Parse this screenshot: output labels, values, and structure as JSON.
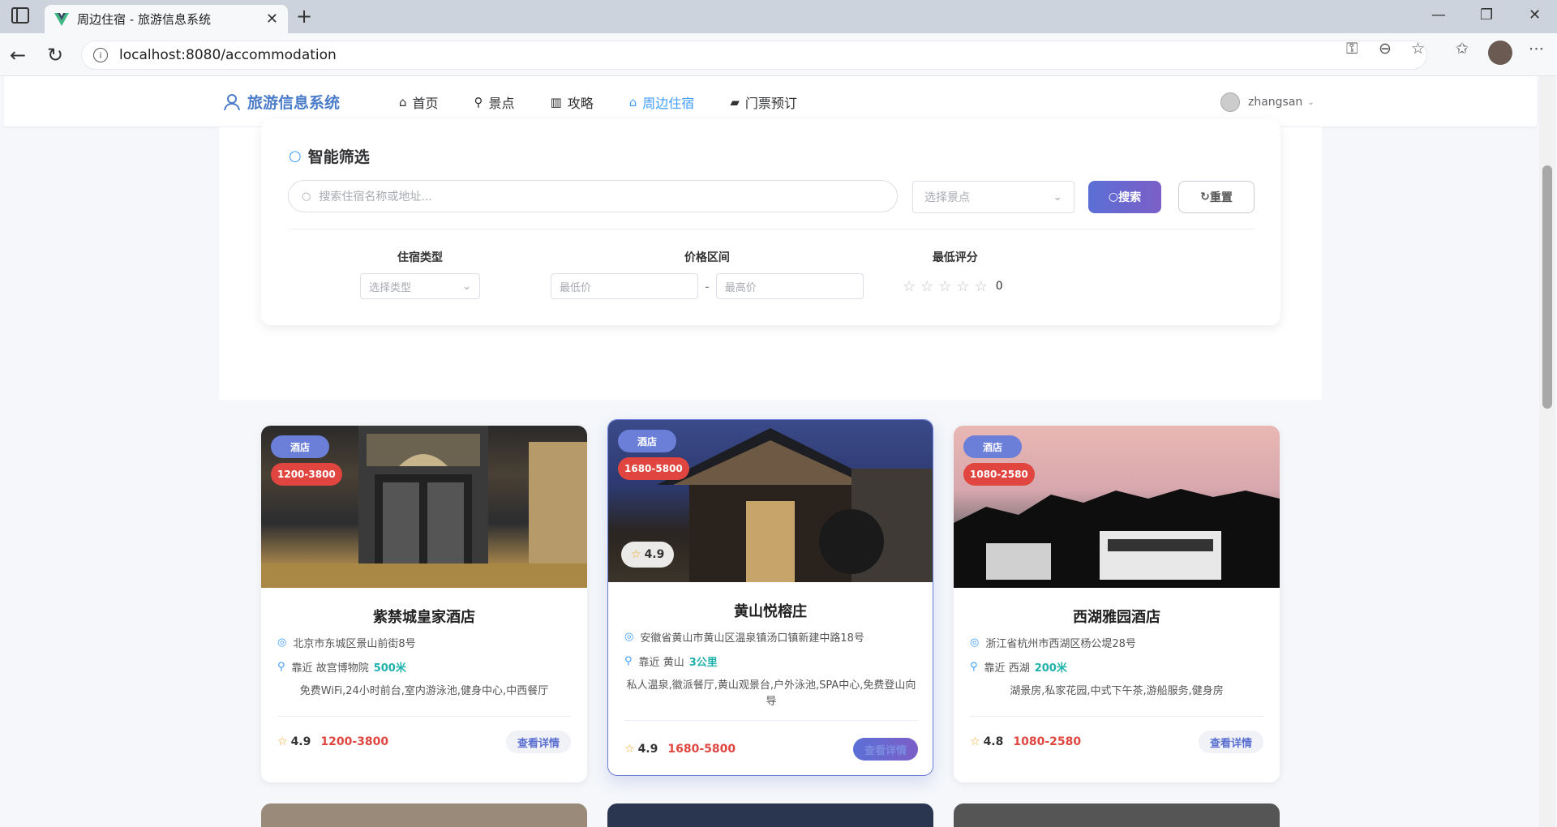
{
  "browser": {
    "tab_title": "周边住宿 - 旅游信息系统",
    "url": "localhost:8080/accommodation"
  },
  "app": {
    "logo": "旅游信息系统",
    "menu": [
      {
        "label": "首页",
        "icon": "home-icon"
      },
      {
        "label": "景点",
        "icon": "bicycle-icon"
      },
      {
        "label": "攻略",
        "icon": "book-icon"
      },
      {
        "label": "周边住宿",
        "icon": "house-icon",
        "active": true
      },
      {
        "label": "门票预订",
        "icon": "ticket-icon"
      }
    ],
    "username": "zhangsan"
  },
  "filter": {
    "title": "智能筛选",
    "search_placeholder": "搜索住宿名称或地址...",
    "attraction_placeholder": "选择景点",
    "search_btn": "搜索",
    "reset_btn": "重置",
    "type_label": "住宿类型",
    "type_placeholder": "选择类型",
    "price_label": "价格区间",
    "min_price": "最低价",
    "max_price": "最高价",
    "rating_label": "最低评分",
    "rating_value": "0"
  },
  "cards": [
    {
      "type": "酒店",
      "price_badge": "1200-3800",
      "name": "紫禁城皇家酒店",
      "address": "北京市东城区景山前街8号",
      "near_prefix": "靠近",
      "near": "故宫博物院",
      "distance": "500米",
      "facilities": "免费WiFi,24小时前台,室内游泳池,健身中心,中西餐厅",
      "rating": "4.9",
      "price": "1200-3800",
      "detail_btn": "查看详情"
    },
    {
      "type": "酒店",
      "price_badge": "1680-5800",
      "name": "黄山悦榕庄",
      "address": "安徽省黄山市黄山区温泉镇汤口镇新建中路18号",
      "near_prefix": "靠近",
      "near": "黄山",
      "distance": "3公里",
      "facilities": "私人温泉,徽派餐厅,黄山观景台,户外泳池,SPA中心,免费登山向导",
      "rating": "4.9",
      "price": "1680-5800",
      "detail_btn": "查看详情"
    },
    {
      "type": "酒店",
      "price_badge": "1080-2580",
      "name": "西湖雅园酒店",
      "address": "浙江省杭州市西湖区杨公堤28号",
      "near_prefix": "靠近",
      "near": "西湖",
      "distance": "200米",
      "facilities": "湖景房,私家花园,中式下午茶,游船服务,健身房",
      "rating": "4.8",
      "price": "1080-2580",
      "detail_btn": "查看详情"
    }
  ],
  "colors": {
    "accent": "#409eff",
    "gradient_start": "#5b6fd6",
    "price_red": "#e0463f",
    "distance_teal": "#20b2aa"
  }
}
